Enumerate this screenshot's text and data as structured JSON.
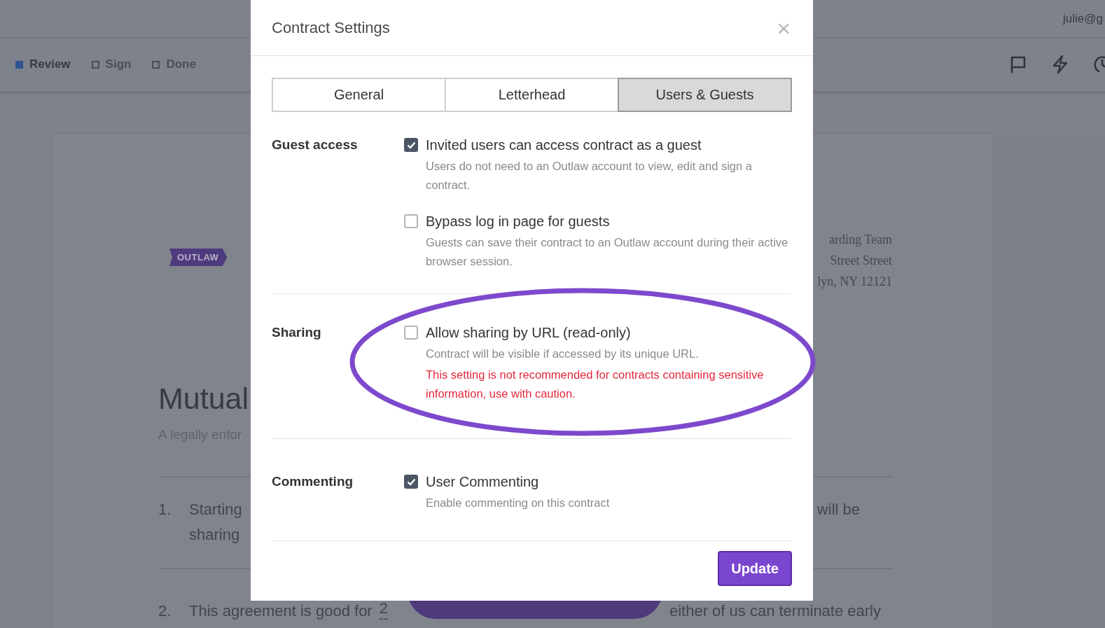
{
  "app_bar": {
    "user": "julie@g",
    "steps": [
      {
        "label": "Review",
        "selected": true
      },
      {
        "label": "Sign",
        "selected": false
      },
      {
        "label": "Done",
        "selected": false
      }
    ]
  },
  "document": {
    "logo": "OUTLAW",
    "address": [
      "arding Team",
      "Street Street",
      "lyn, NY 12121"
    ],
    "title": "Mutual",
    "subtitle": "A legally enfor",
    "clauses": [
      {
        "number": "1.",
        "lines": [
          "Starting",
          "sharing"
        ],
        "right": "will be"
      },
      {
        "number": "2.",
        "lines": [
          "This agreement is good for"
        ],
        "blank": "2",
        "right": "either of us can terminate early"
      }
    ]
  },
  "dialog": {
    "title": "Contract Settings",
    "close": "×",
    "tabs": [
      {
        "label": "General",
        "selected": false
      },
      {
        "label": "Letterhead",
        "selected": false
      },
      {
        "label": "Users & Guests",
        "selected": true
      }
    ],
    "sections": [
      {
        "label": "Guest access",
        "options": [
          {
            "label": "Invited users can access contract as a guest",
            "checked": true,
            "description": "Users do not need to an Outlaw account to view, edit and sign a contract."
          },
          {
            "label": "Bypass log in page for guests",
            "checked": false,
            "description": "Guests can save their contract to an Outlaw account during their active browser session."
          }
        ]
      },
      {
        "label": "Sharing",
        "options": [
          {
            "label": "Allow sharing by URL (read-only)",
            "checked": false,
            "description": "Contract will be visible if accessed by its unique URL.",
            "warning": "This setting is not recommended for contracts containing sensitive information, use with caution."
          }
        ]
      },
      {
        "label": "Commenting",
        "options": [
          {
            "label": "User Commenting",
            "checked": true,
            "description": "Enable commenting on this contract"
          }
        ]
      }
    ],
    "button": "Update"
  }
}
